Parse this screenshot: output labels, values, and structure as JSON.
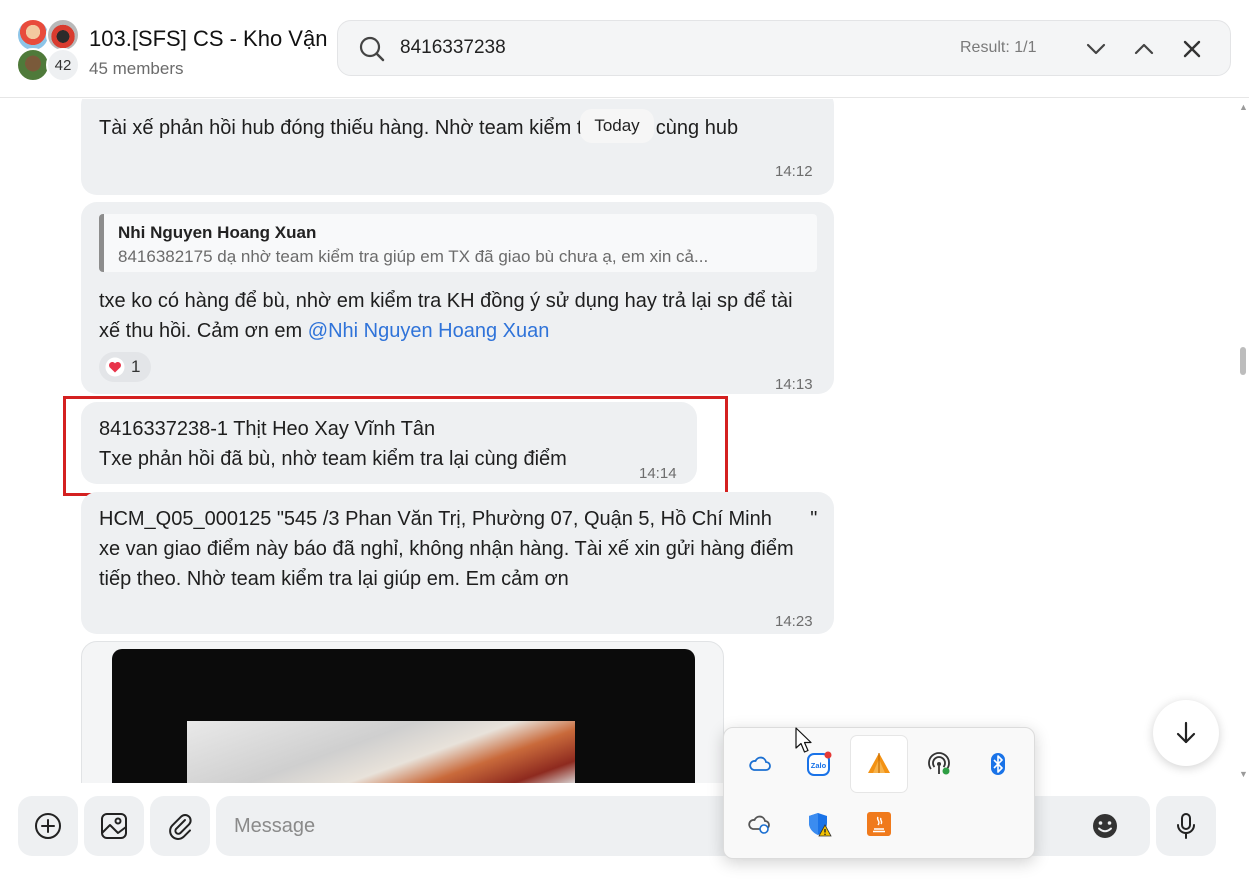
{
  "header": {
    "group_title": "103.[SFS] CS - Kho Vận",
    "member_count": "45 members",
    "avatar_overflow": "42"
  },
  "search": {
    "query": "8416337238",
    "result": "Result: 1/1"
  },
  "chat": {
    "date_divider": "Today",
    "messages": [
      {
        "text": "Tài xế phản hồi hub đóng thiếu hàng. Nhờ team kiểm tra thêm cùng hub",
        "time": "14:12"
      },
      {
        "quote_author": "Nhi Nguyen Hoang Xuan",
        "quote_text": "8416382175 dạ nhờ team kiểm tra giúp em TX đã giao bù chưa ạ, em xin cả...",
        "text": "txe ko có hàng để bù, nhờ em kiểm tra KH đồng ý sử dụng hay trả lại sp để tài xế thu hồi. Cảm ơn em ",
        "mention": "@Nhi Nguyen Hoang Xuan",
        "reaction_count": "1",
        "time": "14:13"
      },
      {
        "line1": "8416337238-1 Thịt Heo Xay Vĩnh Tân",
        "line2": "Txe phản hồi đã bù, nhờ team kiểm tra lại cùng điểm",
        "time": "14:14"
      },
      {
        "text": "HCM_Q05_000125\t\"545 /3 Phan Văn Trị, Phường 07, Quận 5, Hồ Chí Minh\t\"\nxe van giao điểm này báo đã nghỉ, không nhận hàng. Tài xế xin gửi hàng điểm tiếp theo. Nhờ team kiểm tra lại giúp em. Em cảm ơn",
        "time": "14:23"
      }
    ]
  },
  "composer": {
    "placeholder": "Message"
  },
  "tray_icons": [
    "onedrive-icon",
    "zalo-icon",
    "app-orange-icon",
    "hotspot-icon",
    "bluetooth-icon",
    "onedrive-sync-icon",
    "defender-warning-icon",
    "java-icon"
  ],
  "colors": {
    "bubble": "#eef0f2",
    "mention": "#2f73d9",
    "highlight": "#d42020"
  }
}
